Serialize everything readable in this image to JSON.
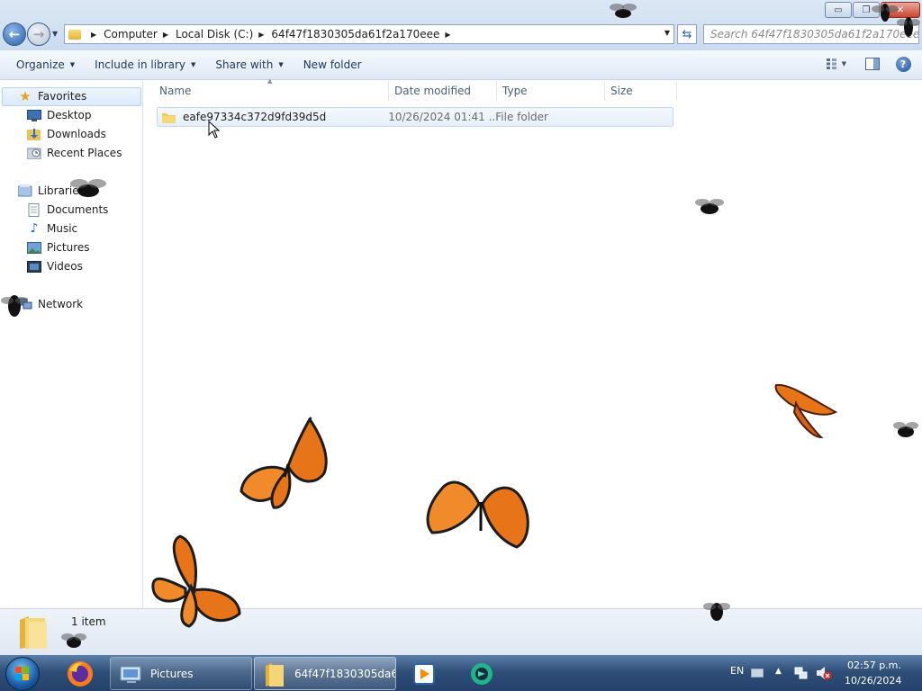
{
  "window": {
    "minimize": "▭",
    "maximize": "❐",
    "close": "✕"
  },
  "address": {
    "crumbs": [
      "Computer",
      "Local Disk (C:)",
      "64f47f1830305da61f2a170eee"
    ],
    "search_placeholder": "Search 64f47f1830305da61f2a170eee"
  },
  "toolbar": {
    "organize": "Organize",
    "include_in_library": "Include in library",
    "share_with": "Share with",
    "new_folder": "New folder"
  },
  "nav": {
    "favorites": "Favorites",
    "desktop": "Desktop",
    "downloads": "Downloads",
    "recent_places": "Recent Places",
    "libraries": "Libraries",
    "documents": "Documents",
    "music": "Music",
    "pictures": "Pictures",
    "videos": "Videos",
    "network": "Network"
  },
  "columns": {
    "name": "Name",
    "date_modified": "Date modified",
    "type": "Type",
    "size": "Size"
  },
  "files": [
    {
      "name": "eafe97334c372d9fd39d5d",
      "date_modified": "10/26/2024 01:41 ...",
      "type": "File folder",
      "size": ""
    }
  ],
  "details": {
    "count": "1 item"
  },
  "taskbar": {
    "tasks": {
      "pictures": "Pictures",
      "folder": "64f47f1830305da6..."
    },
    "tray": {
      "language": "EN",
      "time": "02:57 p.m.",
      "date": "10/26/2024"
    }
  }
}
